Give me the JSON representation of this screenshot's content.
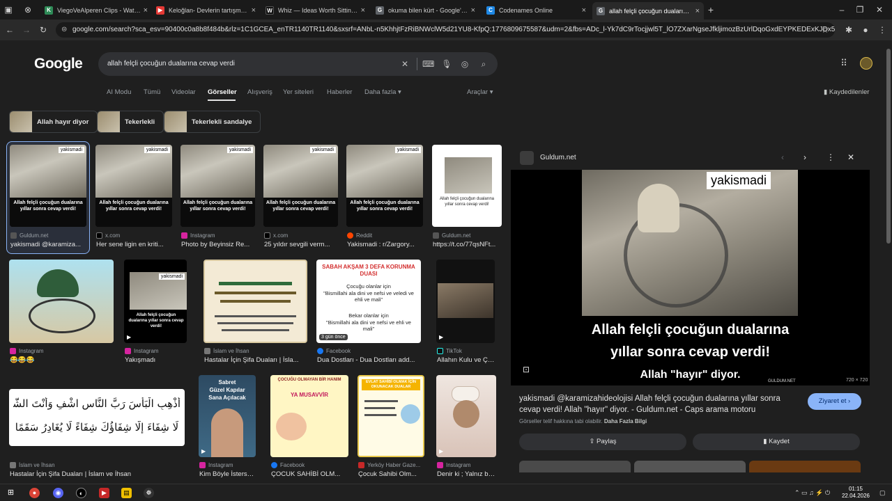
{
  "tabs": [
    {
      "title": "ViegoVeAlperen Clips - Watch l",
      "fav_color": "#2e8b57",
      "fav_glyph": "K"
    },
    {
      "title": "Keloğlan- Devlerin tartışması -",
      "fav_color": "#e53935",
      "fav_glyph": "▶"
    },
    {
      "title": "Whiz — Ideas Worth Sitting W",
      "fav_color": "#111111",
      "fav_glyph": "W"
    },
    {
      "title": "okuma bilen kürt - Google'da A",
      "fav_color": "#5f6368",
      "fav_glyph": "G"
    },
    {
      "title": "Codenames Online",
      "fav_color": "#1e88e5",
      "fav_glyph": "C"
    },
    {
      "title": "allah felçli çocuğun dualarına c",
      "fav_color": "#5f6368",
      "fav_glyph": "G"
    }
  ],
  "address": "google.com/search?sca_esv=90400c0a8b8f484b&rlz=1C1GCEA_enTR1140TR1140&sxsrf=ANbL-n5KhhjtFzRiBNWclW5d21YU8-KfpQ:1776809675587&udm=2&fbs=ADc_l-Yk7dC9rTocjjwl5T_lO7ZXarNgseJfkljimozBzUrlDqoGxdEYPKEDExKJDx55gh7Avc50rSQRR...",
  "google": {
    "logo": "Google",
    "query": "allah felçli çocuğun dualarına cevap verdi",
    "nav": [
      "AI Modu",
      "Tümü",
      "Videolar",
      "Görseller",
      "Alışveriş",
      "Yer siteleri",
      "Haberler",
      "Daha fazla ▾",
      "Araçlar ▾"
    ],
    "saved": "Kaydedilenler",
    "chips": [
      "Allah hayır diyor",
      "Tekerlekli",
      "Tekerlekli sandalye"
    ]
  },
  "results": {
    "r1": {
      "source": "Guldum.net",
      "caption": "yakismadi @karamiza..."
    },
    "r2": {
      "source": "x.com",
      "caption": "Her sene ligin en kriti..."
    },
    "r3": {
      "source": "Instagram",
      "caption": "Photo by Beyinsiz Re..."
    },
    "r4": {
      "source": "x.com",
      "caption": "25 yıldır sevgili verm..."
    },
    "r5": {
      "source": "Reddit",
      "caption": "Yakismadi : r/Zargory..."
    },
    "r6": {
      "source": "Guldum.net",
      "caption": "https://t.co/77qsNFt..."
    },
    "r7": {
      "source": "Instagram",
      "caption": "😂😂😂"
    },
    "r8": {
      "source": "Instagram",
      "caption": "Yakışmadı"
    },
    "r9": {
      "source": "İslam ve İhsan",
      "caption": "Hastalar İçin Şifa Duaları | İsla..."
    },
    "r10": {
      "source": "Facebook",
      "caption": "Dua Dostları - Dua Dostları add..."
    },
    "r11": {
      "source": "TikTok",
      "caption": "Allahın Kulu ve Çoc..."
    },
    "r12": {
      "source": "İslam ve İhsan",
      "caption": "Hastalar İçin Şifa Duaları | İslam ve İhsan"
    },
    "r13": {
      "source": "Instagram",
      "caption": "Kim Böyle İsterse ..."
    },
    "r14": {
      "source": "Facebook",
      "caption": "ÇOCUK SAHİBİ OLM..."
    },
    "r15": {
      "source": "Yerköy Haber Gaze...",
      "caption": "Çocuk Sahibi Olm..."
    },
    "r16": {
      "source": "Instagram",
      "caption": "Denir ki ; Yalnız bir..."
    }
  },
  "thumb_text": {
    "tag": "yakismadi",
    "wheel_caption": "Allah felçli çocuğun dualarına yıllar sonra cevap verdi!",
    "wheel_sub": "Allah \"hayır\" diyor.",
    "prayer_title": "SABAH AKŞAM 3 DEFA KORUNMA DUASI",
    "prayer_l1": "Çocuğu olanlar için",
    "prayer_l2": "\"Bismillahi ala dini ve nefsi ve veledi ve ehli ve mali\"",
    "prayer_l3": "Bekar olanlar için",
    "prayer_l4": "\"Bismillahi ala dini ve nefsi ve ehli ve mali\"",
    "badge": "3 gün önce",
    "sabret_l1": "Sabret",
    "sabret_l2": "Güzel Kapılar",
    "sabret_l3": "Sana Açılacak",
    "arabic_l1": "أَذْهِبِ الْبَأْسَ رَبَّ النَّاسِ اشْفِ وَأَنْتَ الشَّافِي",
    "arabic_l2": "لَا شِفَاءَ إِلَّا شِفَاؤُكَ شِفَاءً لَا يُغَادِرُ سَقَمًا",
    "musavvir_title": "ÇOCUĞU OLMAYAN BİR HANIM",
    "musavvir_name": "YA MUSAVVİR",
    "evlat_title": "EVLAT SAHİBİ OLMAK İÇİN OKUNACAK DUALAR"
  },
  "panel": {
    "site": "Guldum.net",
    "tag": "yakismadi",
    "line1": "Allah felçli çocuğun dualarına",
    "line2": "yıllar sonra cevap verdi!",
    "line3": "Allah \"hayır\" diyor.",
    "watermark": "GULDUM.NET",
    "dims": "720 × 720",
    "title": "yakismadi @karamizahideolojisi Allah felçli çocuğun dualarına yıllar sonra cevap verdi! Allah \"hayır\" diyor. - Guldum.net - Caps arama motoru",
    "copyright": "Görseller telif hakkına tabi olabilir.",
    "more_info": "Daha Fazla Bilgi",
    "visit": "Ziyaret et ›",
    "share": "Paylaş",
    "save": "Kaydet"
  },
  "taskbar": {
    "time": "01:15",
    "date": "22.04.2026"
  }
}
